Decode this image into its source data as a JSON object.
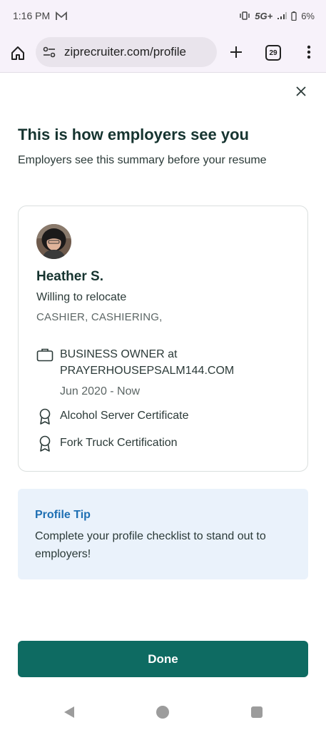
{
  "status_bar": {
    "time": "1:16 PM",
    "network": "5G+",
    "battery": "6%",
    "icons": [
      "gmail-icon",
      "vibrate-icon",
      "signal-icon",
      "battery-icon"
    ]
  },
  "browser": {
    "url": "ziprecruiter.com/profile",
    "tab_count": "29",
    "icons": [
      "home-icon",
      "site-settings-icon",
      "new-tab-icon",
      "tab-switcher-icon",
      "more-menu-icon"
    ]
  },
  "page": {
    "title": "This is how employers see you",
    "subtitle": "Employers see this summary before your resume"
  },
  "profile": {
    "name": "Heather S.",
    "relocate": "Willing to relocate",
    "job_titles": "CASHIER, CASHIERING,",
    "job": {
      "title": "BUSINESS OWNER at PRAYERHOUSEPSALM144.COM",
      "dates": "Jun 2020 - Now"
    },
    "certifications": [
      "Alcohol Server Certificate",
      "Fork Truck Certification"
    ]
  },
  "tip": {
    "title": "Profile Tip",
    "body": "Complete your profile checklist to stand out to employers!"
  },
  "done_label": "Done",
  "colors": {
    "primary": "#0e6b62",
    "heading": "#163430",
    "tip_bg": "#eaf2fb",
    "tip_title": "#1e6fb3"
  }
}
